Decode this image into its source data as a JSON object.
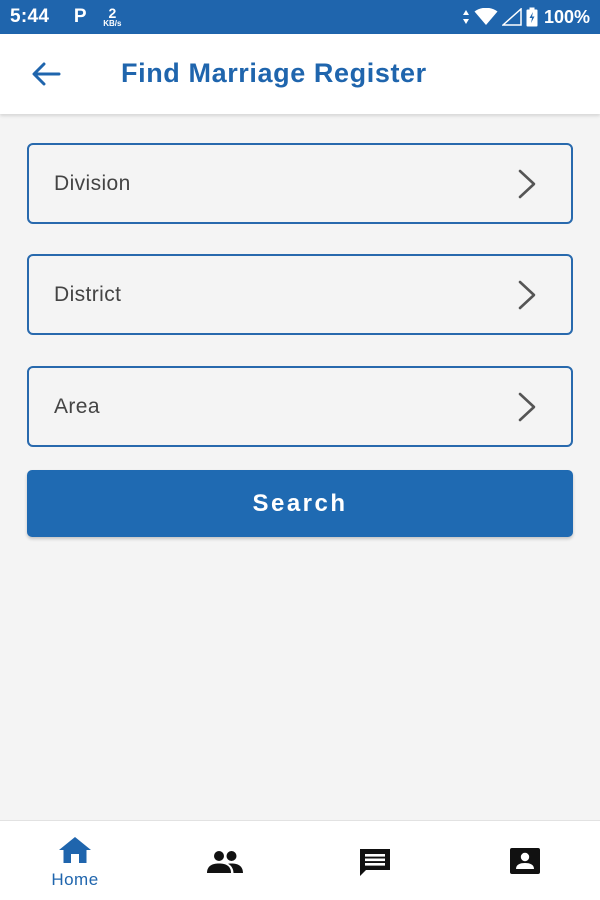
{
  "status_bar": {
    "time": "5:44",
    "p_icon": "P",
    "speed_value": "2",
    "speed_unit": "KB/s",
    "battery": "100%"
  },
  "app_bar": {
    "title": "Find Marriage Register",
    "back_icon": "arrow-back-icon"
  },
  "form": {
    "fields": [
      {
        "label": "Division"
      },
      {
        "label": "District"
      },
      {
        "label": "Area"
      }
    ],
    "search_label": "Search"
  },
  "bottom_nav": {
    "items": [
      {
        "label": "Home",
        "icon": "home-icon",
        "active": true
      },
      {
        "label": "",
        "icon": "people-icon",
        "active": false
      },
      {
        "label": "",
        "icon": "message-icon",
        "active": false
      },
      {
        "label": "",
        "icon": "profile-card-icon",
        "active": false
      }
    ]
  },
  "colors": {
    "primary": "#1f65ad",
    "button": "#1f6ab2",
    "background": "#f4f4f4",
    "field_border": "#2869ad"
  }
}
